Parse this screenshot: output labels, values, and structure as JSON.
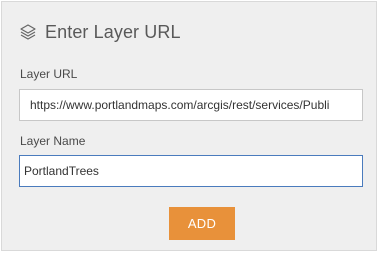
{
  "dialog": {
    "title": "Enter Layer URL",
    "icon": "layers-icon"
  },
  "form": {
    "url_label": "Layer URL",
    "url_value": "https://www.portlandmaps.com/arcgis/rest/services/Publi",
    "name_label": "Layer Name",
    "name_value": "PortlandTrees",
    "add_label": "ADD"
  },
  "colors": {
    "accent": "#e8913a",
    "focus_border": "#4a7bbd",
    "panel_bg": "#efefef"
  }
}
